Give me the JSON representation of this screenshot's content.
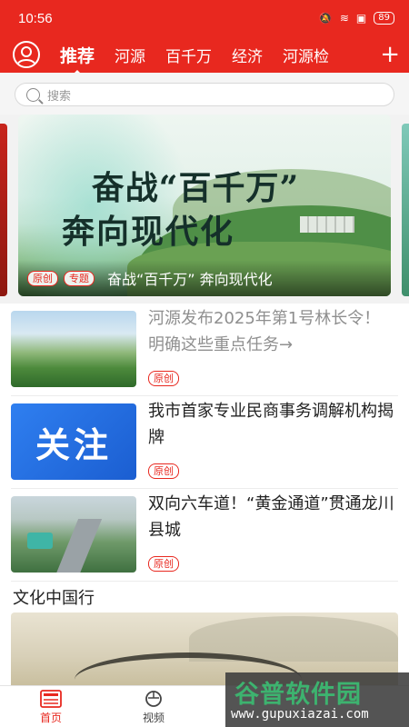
{
  "status_bar": {
    "time": "10:56",
    "battery": "89"
  },
  "nav": {
    "tabs": [
      {
        "label": "推荐",
        "active": true
      },
      {
        "label": "河源"
      },
      {
        "label": "百千万"
      },
      {
        "label": "经济"
      },
      {
        "label": "河源检"
      }
    ],
    "add_label": "+"
  },
  "search": {
    "placeholder": "搜索"
  },
  "banner": {
    "headline_line1": "奋战“百千万”",
    "headline_line2": "奔向现代化",
    "tags": [
      "原创",
      "专题"
    ],
    "caption": "奋战“百千万” 奔向现代化"
  },
  "news": [
    {
      "title": "河源发布2025年第1号林长令！明确这些重点任务→",
      "tag": "原创",
      "read": true,
      "thumb_icon": "forest-landscape"
    },
    {
      "title": "我市首家专业民商事务调解机构揭牌",
      "tag": "原创",
      "thumb_text": "关注"
    },
    {
      "title": "双向六车道！“黄金通道”贯通龙川县城",
      "tag": "原创",
      "thumb_icon": "highway-aerial"
    }
  ],
  "section": {
    "title": "文化中国行"
  },
  "bottom_nav": [
    {
      "label": "首页",
      "icon": "news-icon",
      "active": true
    },
    {
      "label": "视频",
      "icon": "video-icon"
    }
  ],
  "watermark": {
    "line1": "谷普软件园",
    "line2": "www.gupuxiazai.com"
  },
  "colors": {
    "brand": "#e8281f",
    "tag": "#e8281f"
  }
}
